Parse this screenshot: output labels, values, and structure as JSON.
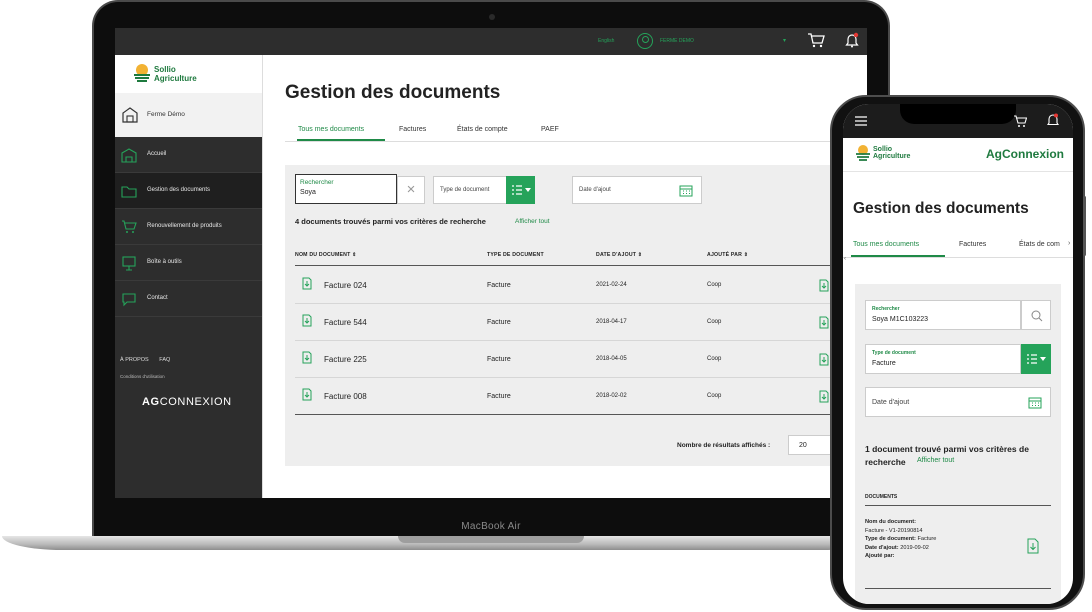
{
  "device": {
    "laptop_label": "MacBook Air"
  },
  "topbar": {
    "language": "English",
    "farm": "FERME DEMO"
  },
  "brand": {
    "line1": "Sollio",
    "line2": "Agriculture"
  },
  "sidebar": {
    "farm": "Ferme Démo",
    "items": [
      {
        "label": "Accueil"
      },
      {
        "label": "Gestion des documents"
      },
      {
        "label": "Renouvellement de produits"
      },
      {
        "label": "Boîte à outils"
      },
      {
        "label": "Contact"
      }
    ],
    "links": [
      "À PROPOS",
      "FAQ"
    ],
    "conditions": "Conditions d'utilisation",
    "logo_bold": "AG",
    "logo_rest": "CONNEXION"
  },
  "main": {
    "title": "Gestion des documents",
    "tabs": [
      "Tous mes documents",
      "Factures",
      "États de compte",
      "PAEF"
    ],
    "search": {
      "label": "Rechercher",
      "value": "Soya"
    },
    "type_placeholder": "Type de document",
    "date_placeholder": "Date d'ajout",
    "results_text": "4 documents trouvés parmi vos critères de recherche",
    "show_all": "Afficher tout",
    "columns": [
      "NOM DU DOCUMENT",
      "TYPE DE DOCUMENT",
      "DATE D'AJOUT",
      "AJOUTÉ PAR"
    ],
    "rows": [
      {
        "name": "Facture 024",
        "type": "Facture",
        "date": "2021-02-24",
        "by": "Coop"
      },
      {
        "name": "Facture 544",
        "type": "Facture",
        "date": "2018-04-17",
        "by": "Coop"
      },
      {
        "name": "Facture 225",
        "type": "Facture",
        "date": "2018-04-05",
        "by": "Coop"
      },
      {
        "name": "Facture 008",
        "type": "Facture",
        "date": "2018-02-02",
        "by": "Coop"
      }
    ],
    "per_page_label": "Nombre de résultats affichés :",
    "per_page_value": "20"
  },
  "phone": {
    "app_name": "AgConnexion",
    "title": "Gestion des documents",
    "tabs": [
      "Tous mes documents",
      "Factures",
      "États de com"
    ],
    "search": {
      "label": "Rechercher",
      "value": "Soya M1C103223"
    },
    "type": {
      "label": "Type de document",
      "value": "Facture"
    },
    "date_placeholder": "Date d'ajout",
    "results_text": "1 document trouvé parmi vos critères de recherche",
    "show_all": "Afficher tout",
    "docs_heading": "DOCUMENTS",
    "doc": {
      "name_label": "Nom du document:",
      "name_value": "Facture - V1-20190814",
      "type_label": "Type de document:",
      "type_value": "Facture",
      "date_label": "Date d'ajout:",
      "date_value": "2019-09-02",
      "by_label": "Ajouté par:"
    }
  },
  "colors": {
    "brand_green": "#1f8a47",
    "button_green": "#25a35a",
    "dark_bg": "#2d2d2d"
  }
}
